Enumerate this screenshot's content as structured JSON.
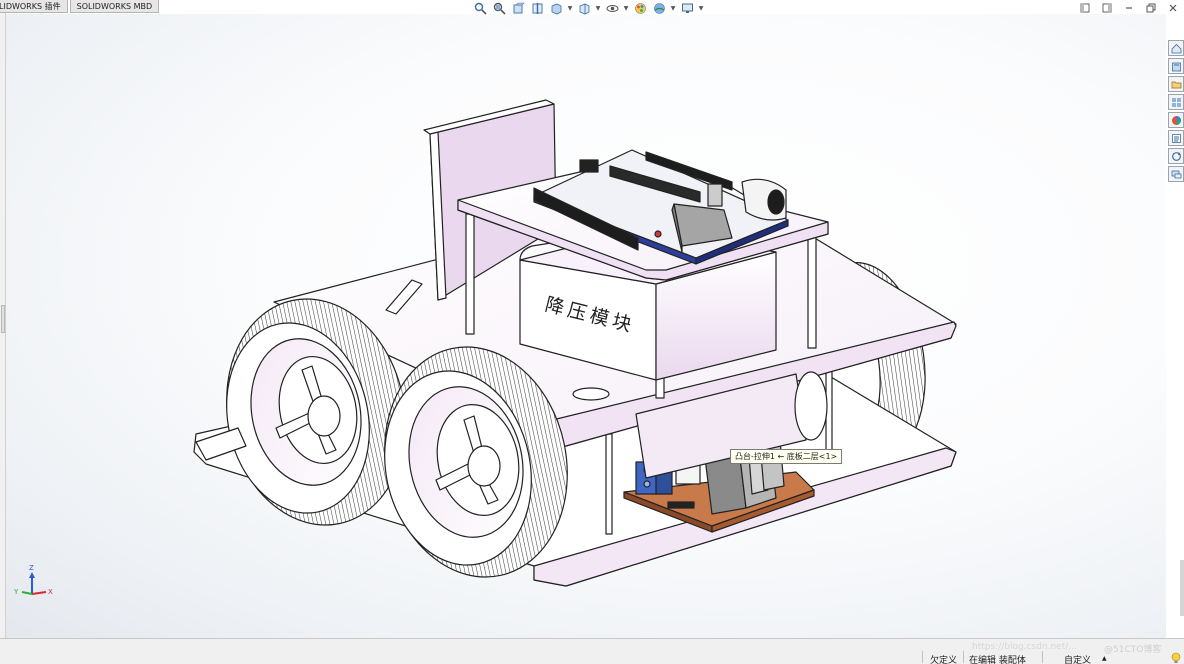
{
  "tabs": [
    {
      "label": "LIDWORKS 插件"
    },
    {
      "label": "SOLIDWORKS MBD"
    }
  ],
  "hud_icons": [
    "zoom-to-fit-icon",
    "zoom-area-icon",
    "previous-view-icon",
    "section-view-icon",
    "view-orientation-icon",
    "display-style-icon",
    "hide-show-icon",
    "edit-appearance-icon",
    "apply-scene-icon",
    "view-settings-icon"
  ],
  "model": {
    "module_label": "降压模块"
  },
  "tooltip": {
    "text": "凸台-拉伸1 ← 底板二层<1>"
  },
  "triad": {
    "x": "X",
    "y": "Y",
    "z": "Z"
  },
  "statusbar": {
    "status1": "欠定义",
    "status2": "在编辑 装配体",
    "units": "自定义",
    "caret": "▲"
  },
  "watermark": {
    "text": "https://blog.csdn.net/...",
    "brand": "@51CTO博客"
  },
  "colors": {
    "accent": "#2b6fb8",
    "model_tint": "#f0e6f4",
    "pcb": "#2c3e9c",
    "heatsink": "#b8b8b8",
    "copper_board": "#c97a4a"
  }
}
